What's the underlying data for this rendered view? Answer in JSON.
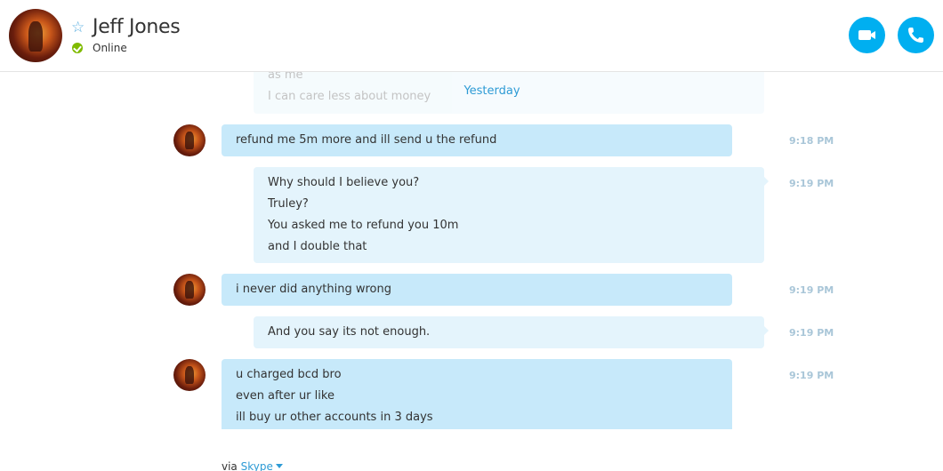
{
  "header": {
    "contact_name": "Jeff Jones",
    "status": "Online",
    "status_color": "#7fba00",
    "accent_color": "#00aff0"
  },
  "conversation": {
    "faded_lines": [
      "as me",
      "I can care less about money"
    ],
    "day_separator": "Yesterday",
    "messages": [
      {
        "direction": "incoming",
        "lines": [
          "refund me 5m more and ill send u the refund"
        ],
        "time": "9:18 PM"
      },
      {
        "direction": "outgoing",
        "lines": [
          "Why should I believe you?",
          "Truley?",
          "You asked me to refund you 10m",
          "and I double that"
        ],
        "time": "9:19 PM"
      },
      {
        "direction": "incoming",
        "lines": [
          "i never did anything wrong"
        ],
        "time": "9:19 PM"
      },
      {
        "direction": "outgoing",
        "lines": [
          "And you say its not enough."
        ],
        "time": "9:19 PM"
      },
      {
        "direction": "incoming",
        "lines": [
          "u charged bcd bro",
          "even after ur like",
          "ill buy ur other accounts in 3 days"
        ],
        "time": "9:19 PM"
      }
    ]
  },
  "footer": {
    "via_label": "via",
    "via_link": "Skype"
  }
}
